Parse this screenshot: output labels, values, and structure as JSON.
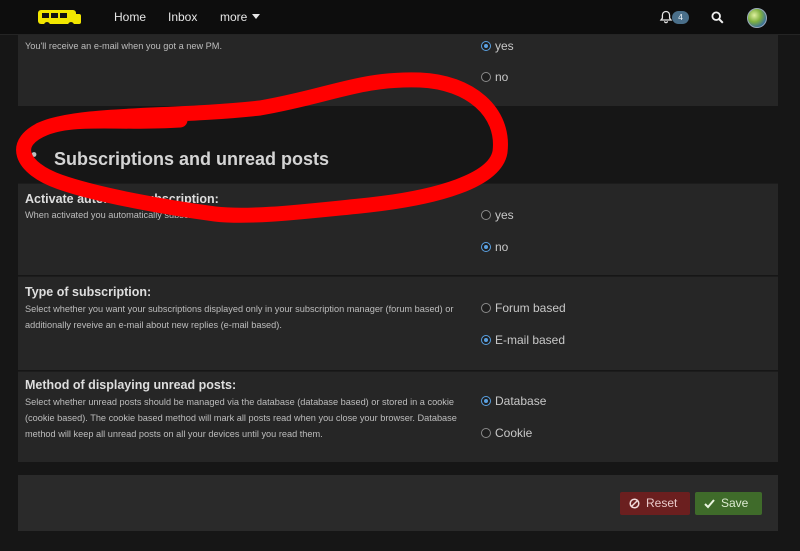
{
  "nav": {
    "home": "Home",
    "inbox": "Inbox",
    "more": "more",
    "notification_count": "4"
  },
  "top_panel": {
    "desc": "You'll receive an e-mail when you got a new PM.",
    "options": [
      {
        "label": "yes",
        "checked": true
      },
      {
        "label": "no",
        "checked": false
      }
    ]
  },
  "section": {
    "title": "Subscriptions and unread posts"
  },
  "rows": [
    {
      "title": "Activate automatic subscription:",
      "desc": "When activated you automatically subscribe to topics you reply to.",
      "options": [
        {
          "label": "yes",
          "checked": false
        },
        {
          "label": "no",
          "checked": true
        }
      ]
    },
    {
      "title": "Type of subscription:",
      "desc": "Select whether you want your subscriptions displayed only in your subscription manager (forum based) or additionally reveive an e-mail about new replies (e-mail based).",
      "options": [
        {
          "label": "Forum based",
          "checked": false
        },
        {
          "label": "E-mail based",
          "checked": true
        }
      ]
    },
    {
      "title": "Method of displaying unread posts:",
      "desc": "Select whether unread posts should be managed via the database (database based) or stored in a cookie (cookie based). The cookie based method will mark all posts read when you close your browser. Database method will keep all unread posts on all your devices until you read them.",
      "options": [
        {
          "label": "Database",
          "checked": true
        },
        {
          "label": "Cookie",
          "checked": false
        }
      ]
    }
  ],
  "footer": {
    "reset": "Reset",
    "save": "Save"
  },
  "colors": {
    "accent": "#5aa0e0",
    "reset_bg": "#6b1f1f",
    "save_bg": "#3f6b2a",
    "annotation": "#ff0000"
  }
}
